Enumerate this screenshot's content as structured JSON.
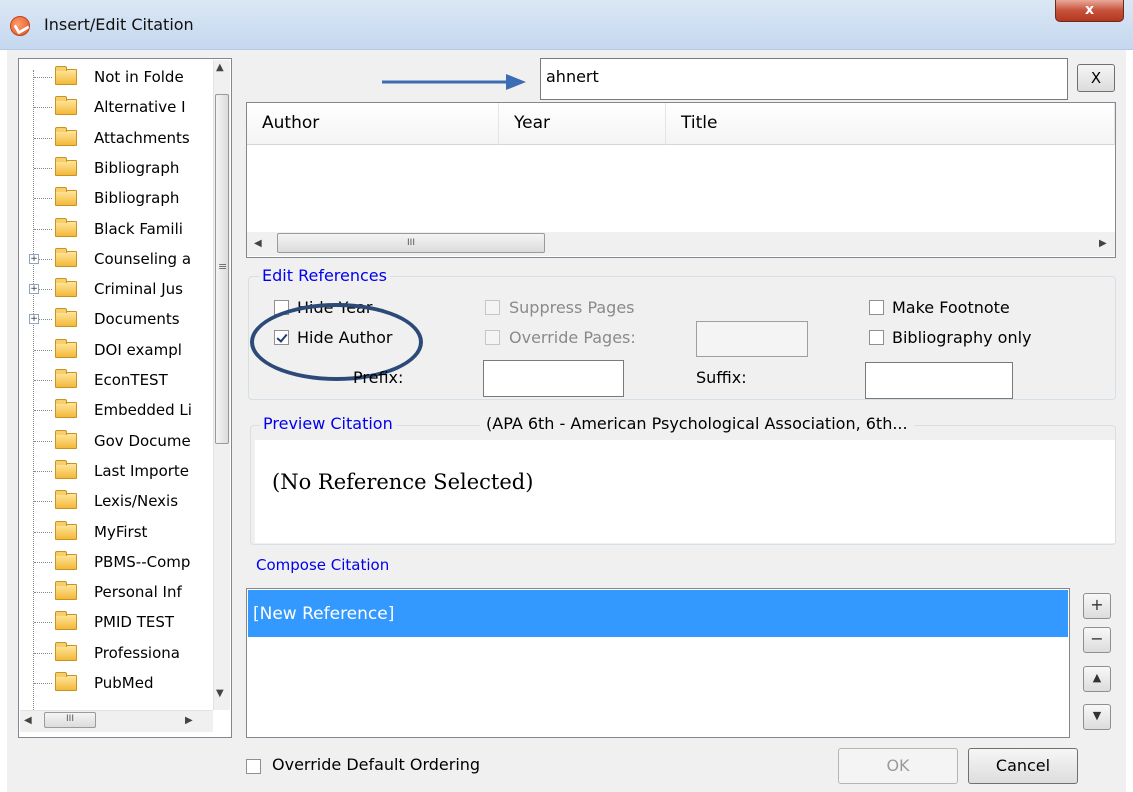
{
  "window": {
    "title": "Insert/Edit Citation",
    "close_label": "x"
  },
  "tree": {
    "items": [
      {
        "label": "Not in Folde",
        "expandable": false
      },
      {
        "label": "Alternative I",
        "expandable": false
      },
      {
        "label": "Attachments",
        "expandable": false
      },
      {
        "label": "Bibliograph",
        "expandable": false
      },
      {
        "label": "Bibliograph",
        "expandable": false
      },
      {
        "label": "Black Famili",
        "expandable": false
      },
      {
        "label": "Counseling a",
        "expandable": true
      },
      {
        "label": "Criminal Jus",
        "expandable": true
      },
      {
        "label": "Documents",
        "expandable": true
      },
      {
        "label": "DOI exampl",
        "expandable": false
      },
      {
        "label": "EconTEST",
        "expandable": false
      },
      {
        "label": "Embedded Li",
        "expandable": false
      },
      {
        "label": "Gov Docume",
        "expandable": false
      },
      {
        "label": "Last Importe",
        "expandable": false
      },
      {
        "label": "Lexis/Nexis",
        "expandable": false
      },
      {
        "label": "MyFirst",
        "expandable": false
      },
      {
        "label": "PBMS--Comp",
        "expandable": false
      },
      {
        "label": "Personal Inf",
        "expandable": false
      },
      {
        "label": "PMID TEST",
        "expandable": false
      },
      {
        "label": "Professiona",
        "expandable": false
      },
      {
        "label": "PubMed",
        "expandable": false
      }
    ]
  },
  "search": {
    "value": "ahnert",
    "clear_label": "X"
  },
  "results": {
    "columns": [
      "Author",
      "Year",
      "Title"
    ]
  },
  "edit_references": {
    "title": "Edit References",
    "hide_year": "Hide Year",
    "hide_author": "Hide Author",
    "suppress_pages": "Suppress Pages",
    "override_pages": "Override Pages:",
    "make_footnote": "Make Footnote",
    "bibliography_only": "Bibliography only",
    "prefix_label": "Prefix:",
    "suffix_label": "Suffix:",
    "hide_author_checked": true
  },
  "preview": {
    "title": "Preview Citation",
    "style": "(APA 6th - American Psychological Association, 6th...",
    "text": "(No Reference Selected)"
  },
  "compose": {
    "title": "Compose Citation",
    "items": [
      "[New Reference]"
    ],
    "buttons": [
      "+",
      "−",
      "▲",
      "▼"
    ]
  },
  "footer": {
    "override_ordering": "Override Default Ordering",
    "ok_label": "OK",
    "cancel_label": "Cancel"
  },
  "colors": {
    "accent": "#3399ff",
    "group_title": "#0000ee",
    "annotation": "#2b4a78",
    "arrow": "#3c6db4"
  }
}
